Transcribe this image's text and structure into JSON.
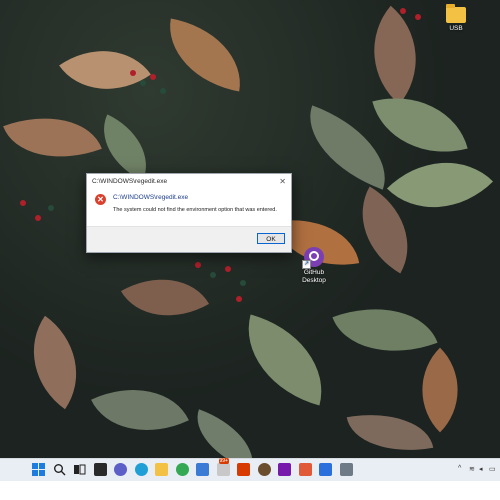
{
  "desktop": {
    "icons": [
      {
        "label": "USB",
        "icon": "folder-icon"
      },
      {
        "label": "GitHub\nDesktop",
        "icon": "github-desktop-icon"
      }
    ]
  },
  "dialog": {
    "title": "C:\\WINDOWS\\regedit.exe",
    "heading": "C:\\WINDOWS\\regedit.exe",
    "message": "The system could not find the environment option that was entered.",
    "ok_label": "OK",
    "close_symbol": "✕",
    "icon": "error-icon",
    "icon_symbol": "✕"
  },
  "taskbar": {
    "items": [
      {
        "name": "start-icon",
        "color": "#1e7be0"
      },
      {
        "name": "search-icon",
        "color": "#2a2a2a"
      },
      {
        "name": "task-view-icon",
        "color": "#2a2a2a"
      },
      {
        "name": "file-explorer-icon",
        "color": "#2a2a2a"
      },
      {
        "name": "chat-icon",
        "color": "#5b5fc7"
      },
      {
        "name": "edge-icon",
        "color": "#1f9fd6"
      },
      {
        "name": "folder-icon",
        "color": "#f3c244"
      },
      {
        "name": "chrome-icon",
        "color": "#34a853"
      },
      {
        "name": "store-icon",
        "color": "#3a7bd5"
      },
      {
        "name": "notification-app-icon",
        "color": "#c8c8c8"
      },
      {
        "name": "office-icon",
        "color": "#d83b01"
      },
      {
        "name": "app-icon",
        "color": "#6b4e2e"
      },
      {
        "name": "onenote-icon",
        "color": "#7719aa"
      },
      {
        "name": "app-red-icon",
        "color": "#e05a3a"
      },
      {
        "name": "photos-icon",
        "color": "#2a6fdb"
      },
      {
        "name": "settings-icon",
        "color": "#6e7a86"
      }
    ],
    "badge": "99+",
    "tray": [
      "^",
      "wifi",
      "speaker",
      "battery"
    ]
  }
}
